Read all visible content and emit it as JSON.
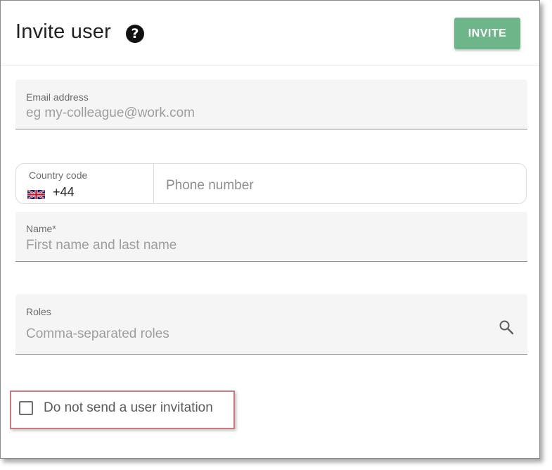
{
  "dialog": {
    "title": "Invite user",
    "help_icon": "question-circle-icon",
    "invite_button": "INVITE"
  },
  "email": {
    "label": "Email address",
    "placeholder": "eg my-colleague@work.com"
  },
  "phone": {
    "country_label": "Country code",
    "country_flag": "uk-flag-icon",
    "dial_code": "+44",
    "placeholder": "Phone number"
  },
  "name": {
    "label": "Name*",
    "placeholder": "First name and last name"
  },
  "roles": {
    "label": "Roles",
    "placeholder": "Comma-separated roles",
    "icon": "search-icon"
  },
  "options": {
    "no_invite_label": "Do not send a user invitation",
    "no_invite_checked": false
  },
  "colors": {
    "invite_button": "#6fb58a",
    "highlight_border": "#c97b7f",
    "field_background": "#f5f5f5"
  }
}
